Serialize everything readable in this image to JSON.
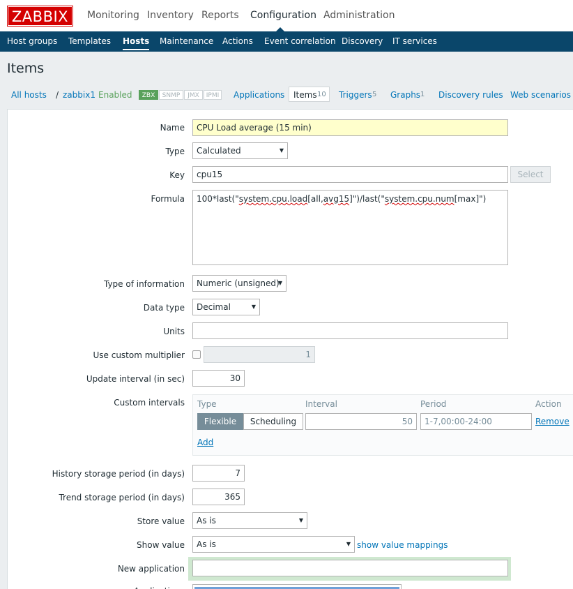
{
  "logo": "ZABBIX",
  "main_nav": [
    "Monitoring",
    "Inventory",
    "Reports",
    "Configuration",
    "Administration"
  ],
  "sub_nav": [
    "Host groups",
    "Templates",
    "Hosts",
    "Maintenance",
    "Actions",
    "Event correlation",
    "Discovery",
    "IT services"
  ],
  "page_title": "Items",
  "breadcrumb": {
    "all_hosts": "All hosts",
    "separator": "/",
    "host": "zabbix1",
    "status": "Enabled",
    "badges": [
      "ZBX",
      "SNMP",
      "JMX",
      "IPMI"
    ],
    "applications": "Applications",
    "items": "Items",
    "items_count": "10",
    "triggers": "Triggers",
    "triggers_count": "5",
    "graphs": "Graphs",
    "graphs_count": "1",
    "discovery_rules": "Discovery rules",
    "web_scenarios": "Web scenarios"
  },
  "form": {
    "name_label": "Name",
    "name_value": "CPU Load average (15 min)",
    "type_label": "Type",
    "type_value": "Calculated",
    "key_label": "Key",
    "key_value": "cpu15",
    "select_button": "Select",
    "formula_label": "Formula",
    "formula_parts": [
      "100*last(\"",
      "system.cpu.load",
      "[all,",
      "avg15",
      "]\")/last(\"",
      "system.cpu.num",
      "[max]\")"
    ],
    "type_info_label": "Type of information",
    "type_info_value": "Numeric (unsigned)",
    "data_type_label": "Data type",
    "data_type_value": "Decimal",
    "units_label": "Units",
    "units_value": "",
    "multiplier_label": "Use custom multiplier",
    "multiplier_value": "1",
    "update_label": "Update interval (in sec)",
    "update_value": "30",
    "custom_intervals_label": "Custom intervals",
    "ci_headers": [
      "Type",
      "Interval",
      "Period",
      "Action"
    ],
    "ci_flexible": "Flexible",
    "ci_scheduling": "Scheduling",
    "ci_interval": "50",
    "ci_period": "1-7,00:00-24:00",
    "ci_remove": "Remove",
    "ci_add": "Add",
    "history_label": "History storage period (in days)",
    "history_value": "7",
    "trend_label": "Trend storage period (in days)",
    "trend_value": "365",
    "store_label": "Store value",
    "store_value": "As is",
    "show_label": "Show value",
    "show_value": "As is",
    "show_mappings": "show value mappings",
    "new_app_label": "New application",
    "new_app_value": "",
    "applications_label": "Applications"
  },
  "colors": {
    "brand": "#d40000",
    "nav": "#0a466a",
    "link": "#0275b8",
    "enabled": "#59a15b",
    "highlight": "#ffffcc"
  }
}
